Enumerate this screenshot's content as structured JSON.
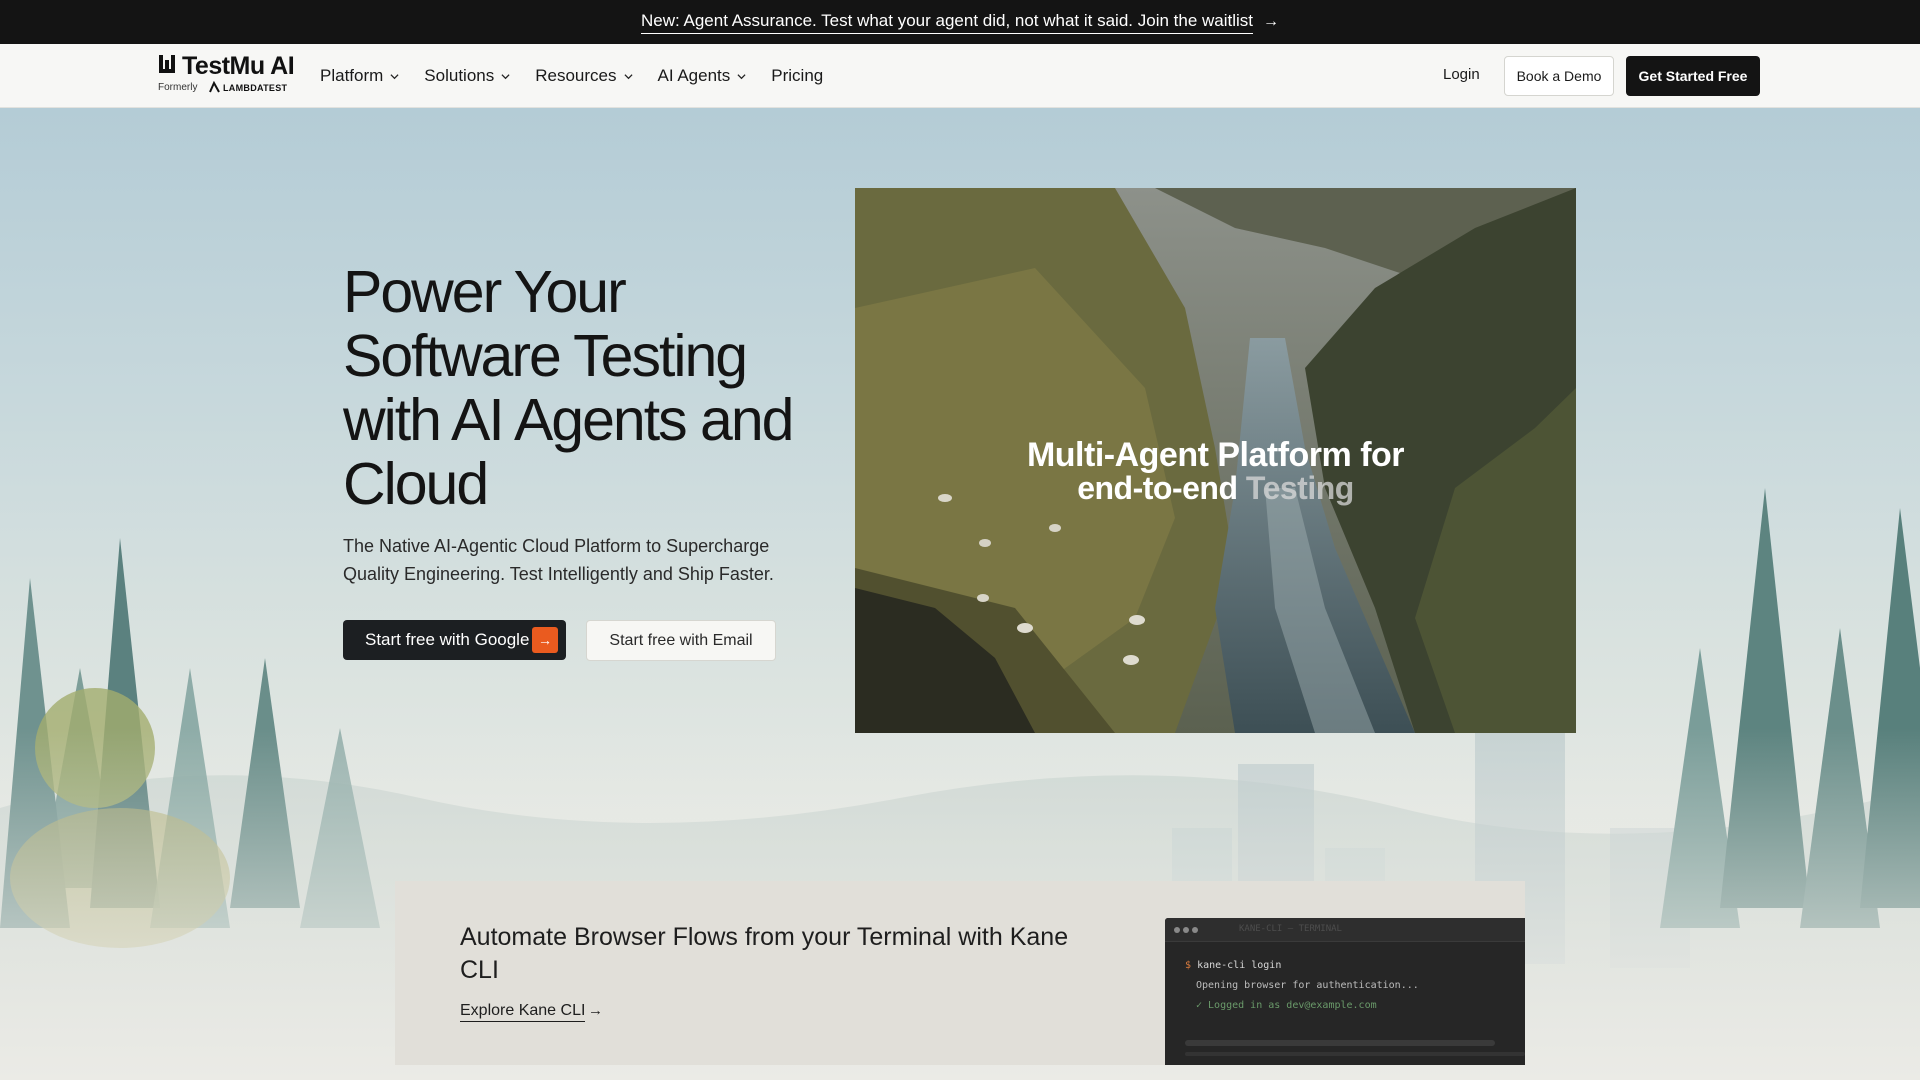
{
  "announcement": {
    "text": "New: Agent Assurance. Test what your agent did, not what it said. Join the waitlist",
    "arrow": "→"
  },
  "logo": {
    "name": "TestMu AI",
    "formerly": "Formerly",
    "former_brand": "LAMBDATEST"
  },
  "nav": {
    "items": [
      {
        "label": "Platform",
        "has_dropdown": true
      },
      {
        "label": "Solutions",
        "has_dropdown": true
      },
      {
        "label": "Resources",
        "has_dropdown": true
      },
      {
        "label": "AI Agents",
        "has_dropdown": true
      },
      {
        "label": "Pricing",
        "has_dropdown": false
      }
    ],
    "login": "Login",
    "book_demo": "Book a Demo",
    "get_started": "Get Started Free"
  },
  "hero": {
    "title": "Power Your Software Testing with AI Agents and Cloud",
    "subtitle": "The Native AI-Agentic Cloud Platform to Supercharge Quality Engineering. Test Intelligently and Ship Faster.",
    "primary_cta": "Start free with Google",
    "primary_cta_icon": "→",
    "secondary_cta": "Start free with Email"
  },
  "media": {
    "overlay_line1": "Multi-Agent Platform for",
    "overlay_line2_a": "end-to-end",
    "overlay_line2_b": "Testing"
  },
  "kane_cli": {
    "title": "Automate Browser Flows from your Terminal with Kane CLI",
    "link": "Explore Kane CLI",
    "link_arrow": "→",
    "terminal": {
      "title": "KANE-CLI — TERMINAL",
      "prompt": "$",
      "command": "kane-cli login",
      "output": "Opening browser for authentication...",
      "success": "✓ Logged in as dev@example.com"
    }
  },
  "colors": {
    "accent": "#ea5b1f",
    "dark": "#141414",
    "sky": "#b4ccd6"
  }
}
